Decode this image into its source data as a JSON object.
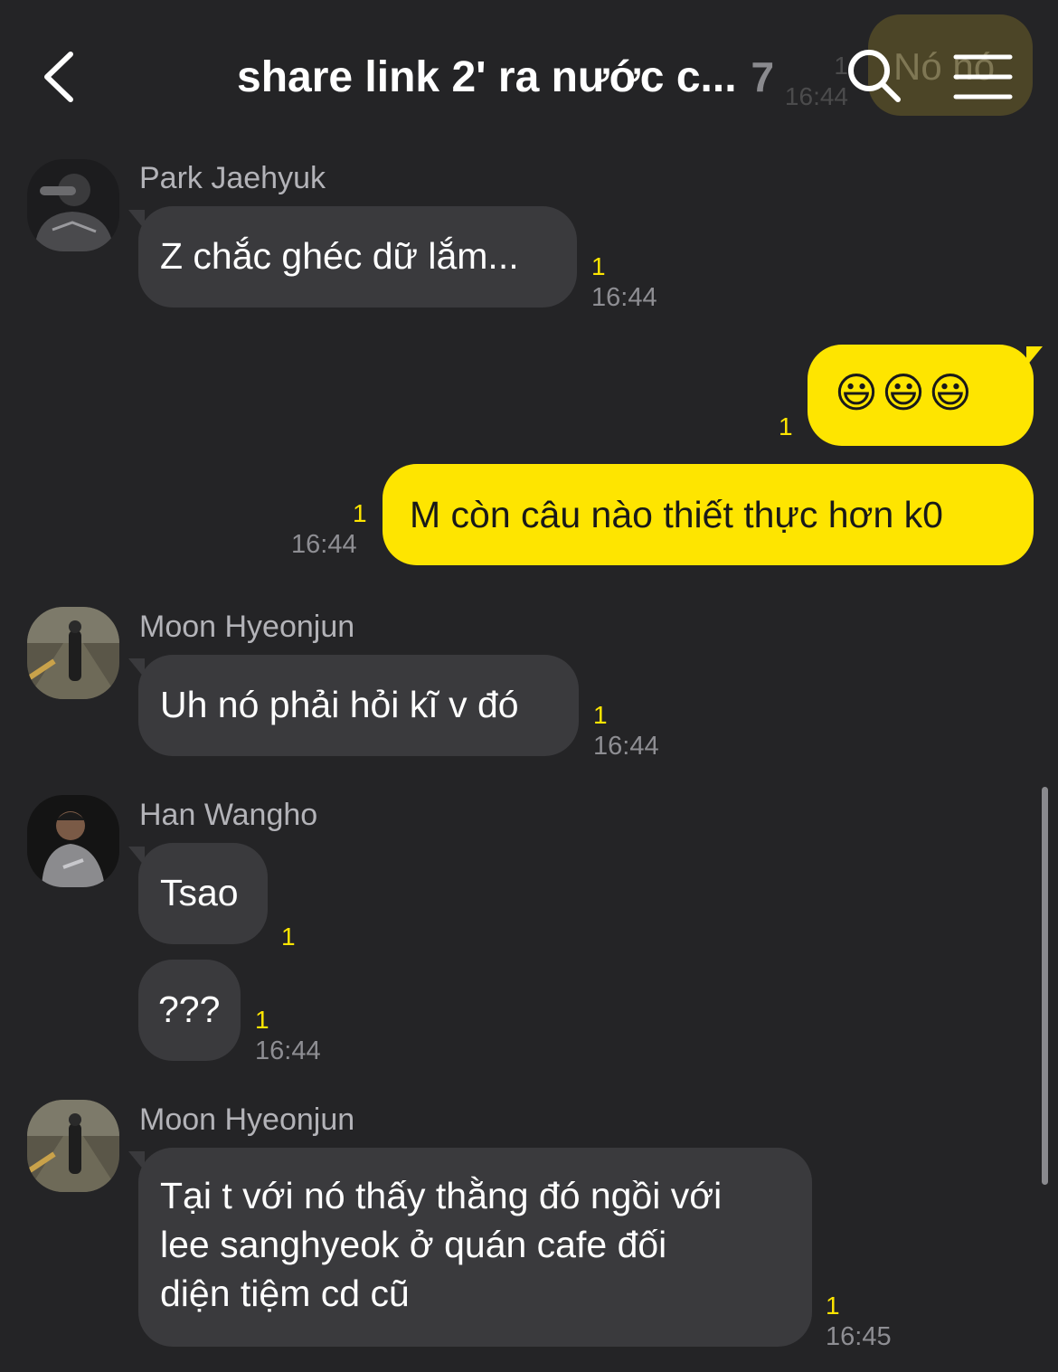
{
  "header": {
    "title": "share link 2' ra nước c...",
    "member_count": "7",
    "ghost_text": "Nó nó",
    "ghost_unread": "1",
    "ghost_time": "16:44"
  },
  "messages": [
    {
      "sender": "Park Jaehyuk",
      "text": "Z chắc ghéc dữ lắm...",
      "unread": "1",
      "time": "16:44"
    },
    {
      "sender": "",
      "text": "😃😃😃",
      "unread": "1",
      "time": ""
    },
    {
      "sender": "",
      "text": "M còn câu nào thiết thực hơn k0",
      "unread": "1",
      "time": "16:44"
    },
    {
      "sender": "Moon Hyeonjun",
      "text": "Uh nó phải hỏi kĩ v đó",
      "unread": "1",
      "time": "16:44"
    },
    {
      "sender": "Han Wangho",
      "text": "Tsao",
      "unread": "1",
      "time": ""
    },
    {
      "sender": "",
      "text": "???",
      "unread": "1",
      "time": "16:44"
    },
    {
      "sender": "Moon Hyeonjun",
      "lines": [
        "Tại t với nó thấy thằng đó ngồi với",
        "lee sanghyeok ở quán cafe đối",
        "diện tiệm cd cũ"
      ],
      "unread": "1",
      "time": "16:45"
    }
  ],
  "colors": {
    "background": "#242426",
    "incoming_bubble": "#3a3a3d",
    "outgoing_bubble": "#fee500",
    "unread": "#fee500",
    "timestamp": "#8e8e93"
  },
  "icons": {
    "back": "chevron-left-icon",
    "search": "search-icon",
    "menu": "hamburger-menu-icon"
  }
}
